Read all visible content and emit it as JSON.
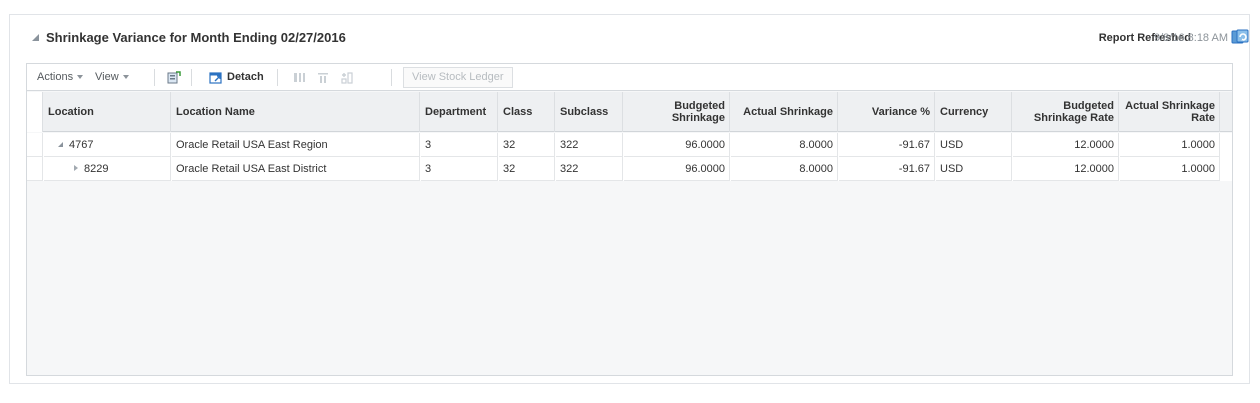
{
  "panel": {
    "title": "Shrinkage Variance for Month Ending 02/27/2016",
    "refresh_label": "Report Refreshed",
    "refresh_time": "9/8/16 8:18 AM"
  },
  "toolbar": {
    "actions_label": "Actions",
    "view_label": "View",
    "detach_label": "Detach",
    "view_stock_ledger_label": "View Stock Ledger"
  },
  "table": {
    "columns": [
      "Location",
      "Location Name",
      "Department",
      "Class",
      "Subclass",
      "Budgeted Shrinkage",
      "Actual Shrinkage",
      "Variance %",
      "Currency",
      "Budgeted Shrinkage Rate",
      "Actual Shrinkage Rate"
    ],
    "rows": [
      {
        "location": "4767",
        "location_name": "Oracle Retail USA East Region",
        "department": "3",
        "class": "32",
        "subclass": "322",
        "budgeted_shrinkage": "96.0000",
        "actual_shrinkage": "8.0000",
        "variance_pct": "-91.67",
        "currency": "USD",
        "budgeted_shrinkage_rate": "12.0000",
        "actual_shrinkage_rate": "1.0000"
      },
      {
        "location": "8229",
        "location_name": "Oracle Retail USA East District",
        "department": "3",
        "class": "32",
        "subclass": "322",
        "budgeted_shrinkage": "96.0000",
        "actual_shrinkage": "8.0000",
        "variance_pct": "-91.67",
        "currency": "USD",
        "budgeted_shrinkage_rate": "12.0000",
        "actual_shrinkage_rate": "1.0000"
      }
    ]
  },
  "icons": {
    "collapse": "collapse-triangle-icon",
    "refresh": "refresh-icon",
    "export": "export-icon",
    "detach": "detach-icon",
    "freeze": "freeze-columns-icon",
    "wrap": "wrap-icon",
    "reorder": "reorder-columns-icon"
  },
  "colors": {
    "header_bg": "#eef0f2",
    "body_bg": "#f6f7f8",
    "border": "#d5d9dd",
    "link_blue": "#2b72c2"
  }
}
